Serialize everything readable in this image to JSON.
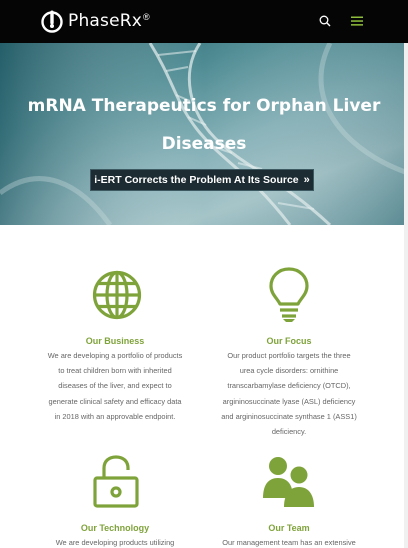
{
  "header": {
    "brand": "PhaseRx",
    "brand_mark": "®",
    "search_icon": "search-icon",
    "menu_icon": "hamburger-menu-icon"
  },
  "hero": {
    "title_line1": "mRNA Therapeutics for Orphan Liver",
    "title_line2": "Diseases",
    "cta_label": "i-ERT Corrects the Problem At Its Source",
    "cta_chevron": "»"
  },
  "colors": {
    "accent": "#7fa33b",
    "header_bg": "#050505",
    "cta_bg": "#1d2c33"
  },
  "features": [
    {
      "icon": "globe-icon",
      "title": "Our Business",
      "lines": [
        "We are developing a portfolio of products",
        "to treat children born with inherited",
        "diseases of the liver, and expect to",
        "generate clinical safety and efficacy data",
        "in 2018 with an approvable endpoint."
      ]
    },
    {
      "icon": "lightbulb-icon",
      "title": "Our Focus",
      "lines": [
        "Our product portfolio targets the three",
        "urea cycle disorders: ornithine",
        "transcarbamylase deficiency (OTCD),",
        "argininosuccinate lyase (ASL) deficiency",
        "and argininosuccinate synthase 1 (ASS1)",
        "deficiency."
      ]
    },
    {
      "icon": "padlock-icon",
      "title": "Our Technology",
      "lines": [
        "We are developing products utilizing"
      ]
    },
    {
      "icon": "team-icon",
      "title": "Our Team",
      "lines": [
        "Our management team has an extensive"
      ]
    }
  ]
}
